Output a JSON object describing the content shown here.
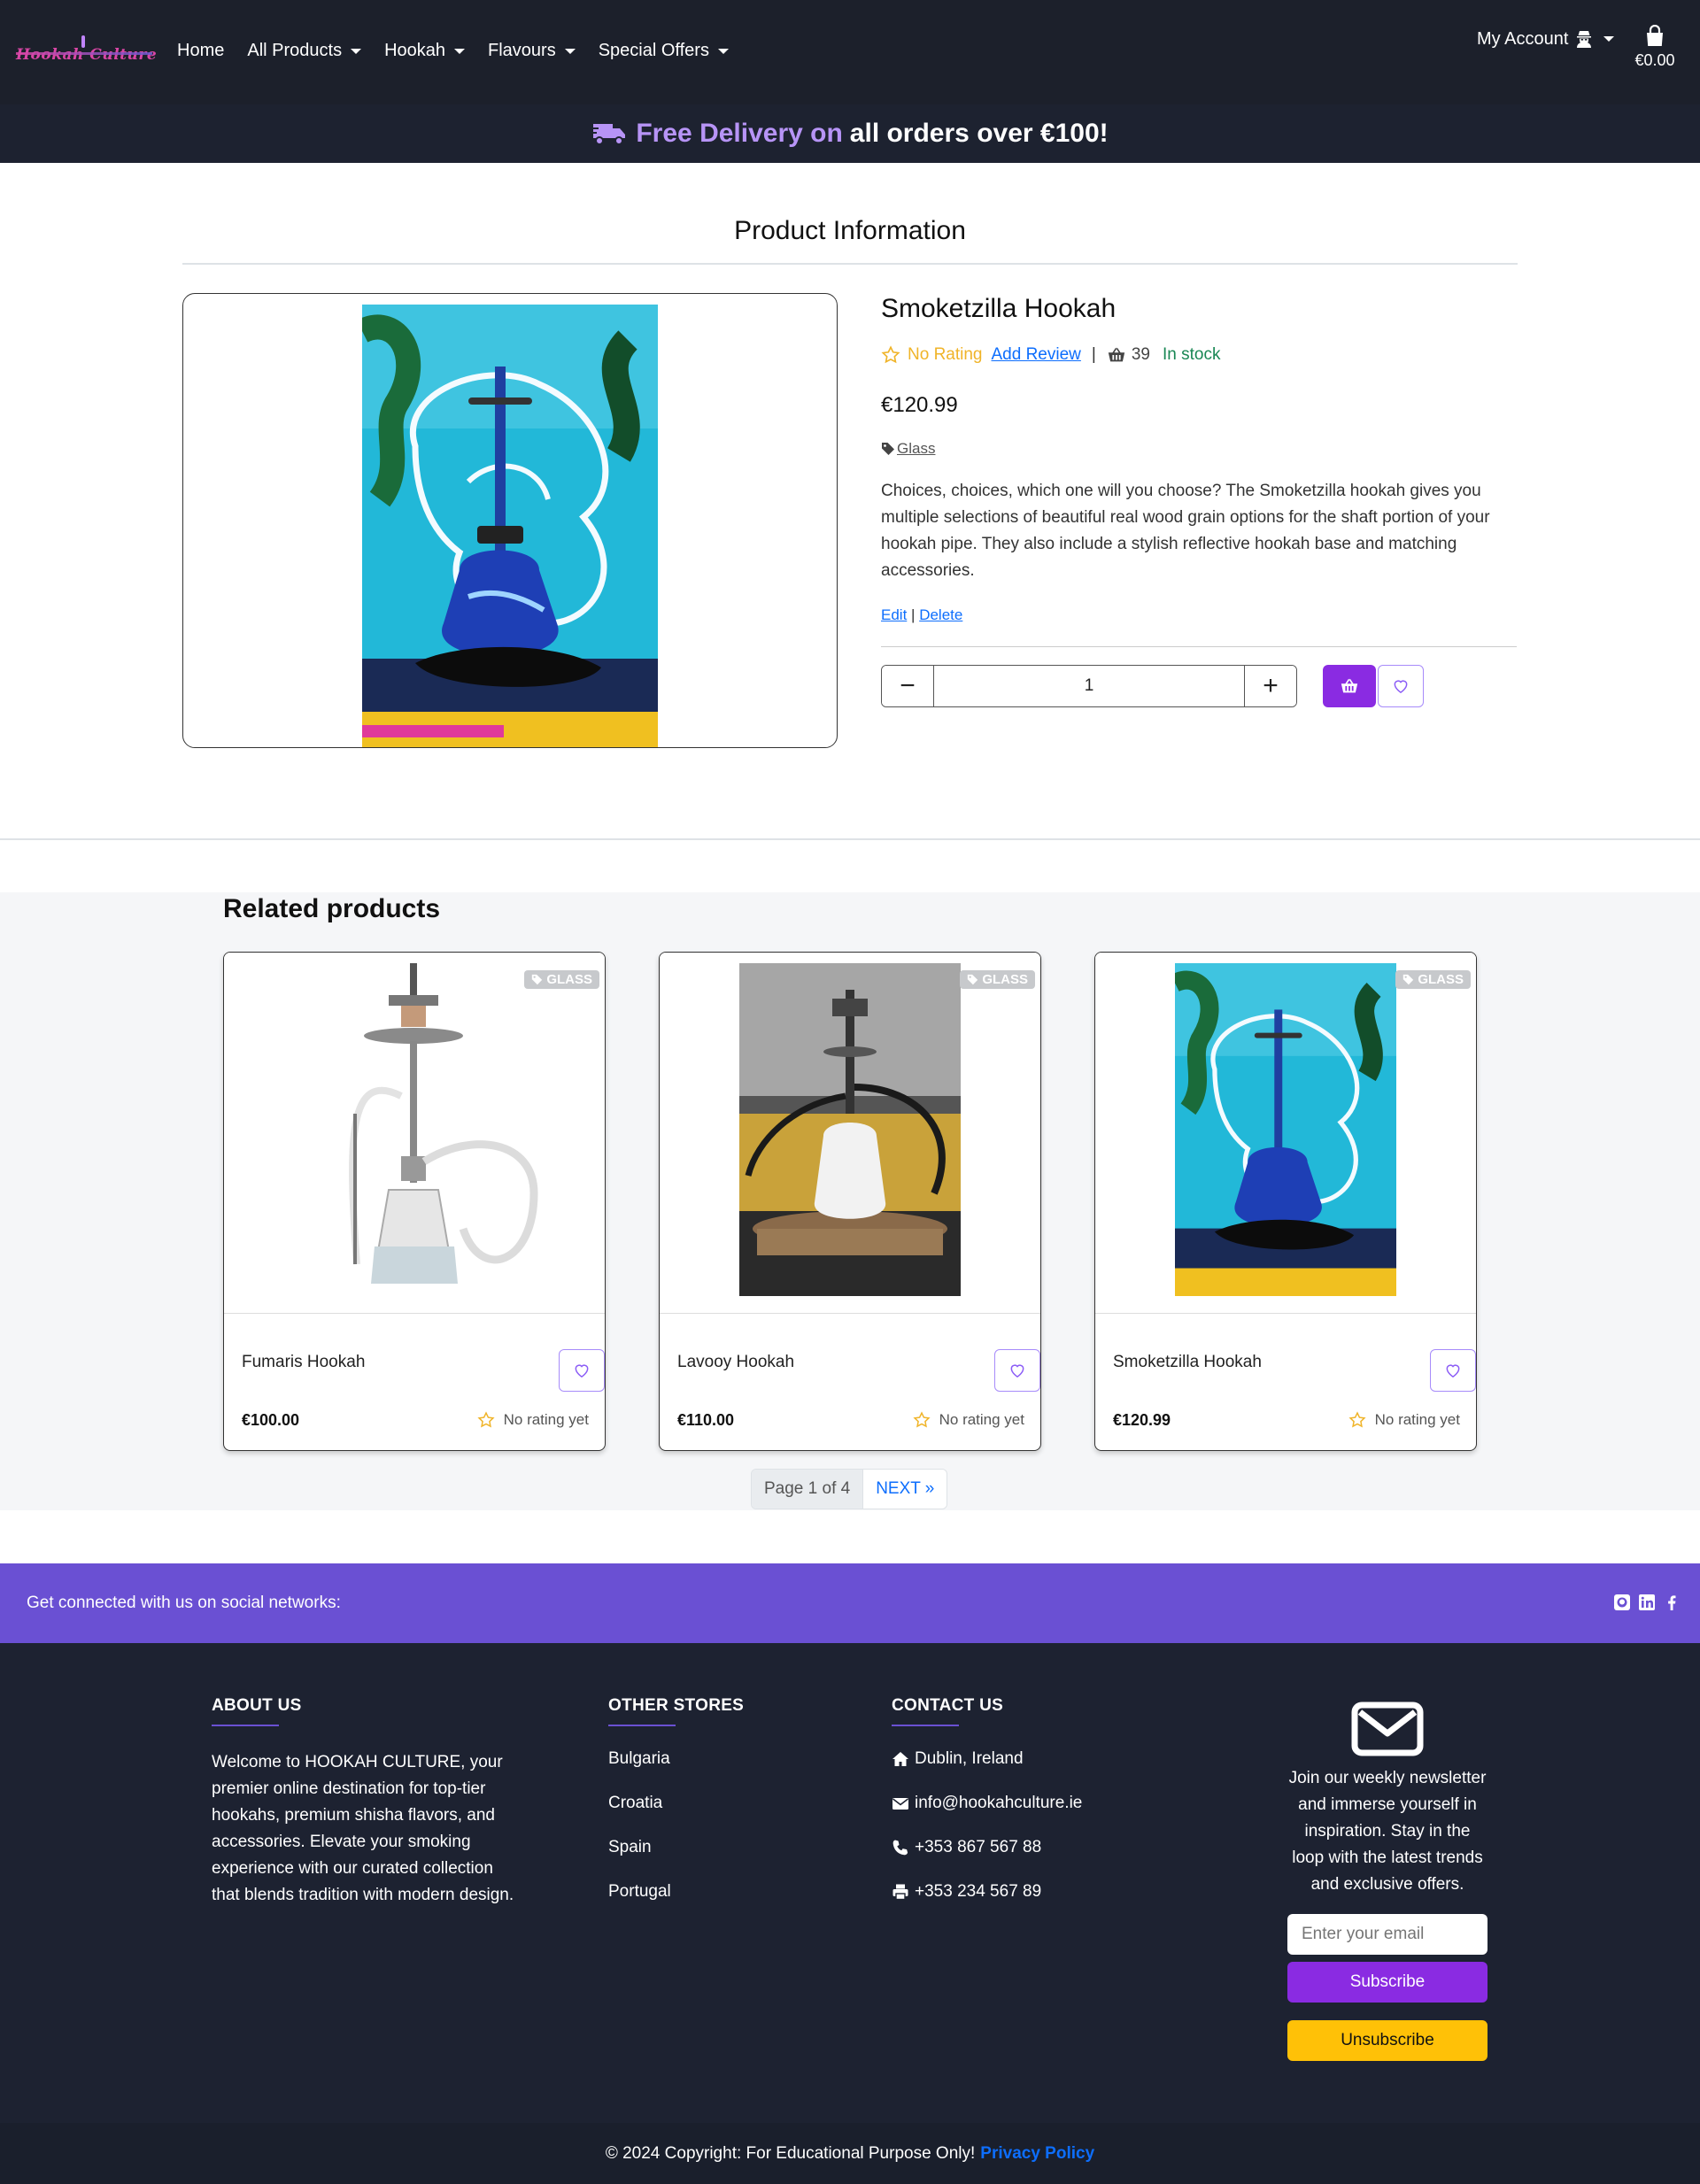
{
  "nav": {
    "logo_text": "Hookah Culture",
    "links": [
      {
        "label": "Home",
        "has_dropdown": false
      },
      {
        "label": "All Products",
        "has_dropdown": true
      },
      {
        "label": "Hookah",
        "has_dropdown": true
      },
      {
        "label": "Flavours",
        "has_dropdown": true
      },
      {
        "label": "Special Offers",
        "has_dropdown": true
      }
    ],
    "account_label": "My Account",
    "account_icon": "user-secret-icon",
    "cart_icon": "shopping-bag-icon",
    "cart_total": "€0.00"
  },
  "promo": {
    "accent": "Free Delivery on",
    "rest": "all orders over €100!",
    "icon": "truck-icon",
    "accent_color": "#b794f6"
  },
  "product": {
    "section_title": "Product Information",
    "name": "Smoketzilla Hookah",
    "rating_text": "No Rating",
    "add_review": "Add Review",
    "separator": "|",
    "stock_count": "39",
    "stock_status": "In stock",
    "price": "€120.99",
    "tag": "Glass",
    "description": "Choices, choices, which one will you choose? The Smoketzilla hookah gives you multiple selections of beautiful real wood grain options for the shaft portion of your hookah pipe. They also include a stylish reflective hookah base and matching accessories.",
    "edit_label": "Edit",
    "admin_separator": "|",
    "delete_label": "Delete",
    "quantity": "1",
    "minus_label": "−",
    "plus_label": "+",
    "brand_color": "#8a2be2"
  },
  "related": {
    "title": "Related products",
    "cards": [
      {
        "name": "Fumaris Hookah",
        "price": "€100.00",
        "badge": "GLASS",
        "rating": "No rating yet"
      },
      {
        "name": "Lavooy Hookah",
        "price": "€110.00",
        "badge": "GLASS",
        "rating": "No rating yet"
      },
      {
        "name": "Smoketzilla Hookah",
        "price": "€120.99",
        "badge": "GLASS",
        "rating": "No rating yet"
      }
    ],
    "pagination": {
      "current": "Page 1 of 4",
      "next": "NEXT »"
    }
  },
  "footer": {
    "social_text": "Get connected with us on social networks:",
    "social_icons": [
      "github-icon",
      "linkedin-icon",
      "facebook-icon"
    ],
    "social_color": "#6a50d3",
    "about_heading": "ABOUT US",
    "about_text": "Welcome to HOOKAH CULTURE, your premier online destination for top-tier hookahs, premium shisha flavors, and accessories. Elevate your smoking experience with our curated collection that blends tradition with modern design.",
    "stores_heading": "OTHER STORES",
    "stores": [
      "Bulgaria",
      "Croatia",
      "Spain",
      "Portugal"
    ],
    "contact_heading": "CONTACT US",
    "contact": [
      {
        "icon": "home-icon",
        "text": "Dublin, Ireland"
      },
      {
        "icon": "envelope-icon",
        "text": "info@hookahculture.ie"
      },
      {
        "icon": "phone-icon",
        "text": "+353 867 567 88"
      },
      {
        "icon": "print-icon",
        "text": "+353 234 567 89"
      }
    ],
    "newsletter_text": "Join our weekly newsletter and immerse yourself in inspiration. Stay in the loop with the latest trends and exclusive offers.",
    "email_placeholder": "Enter your email",
    "subscribe_label": "Subscribe",
    "unsubscribe_label": "Unsubscribe",
    "copyright": "© 2024 Copyright: For Educational Purpose Only!",
    "privacy_label": "Privacy Policy"
  }
}
